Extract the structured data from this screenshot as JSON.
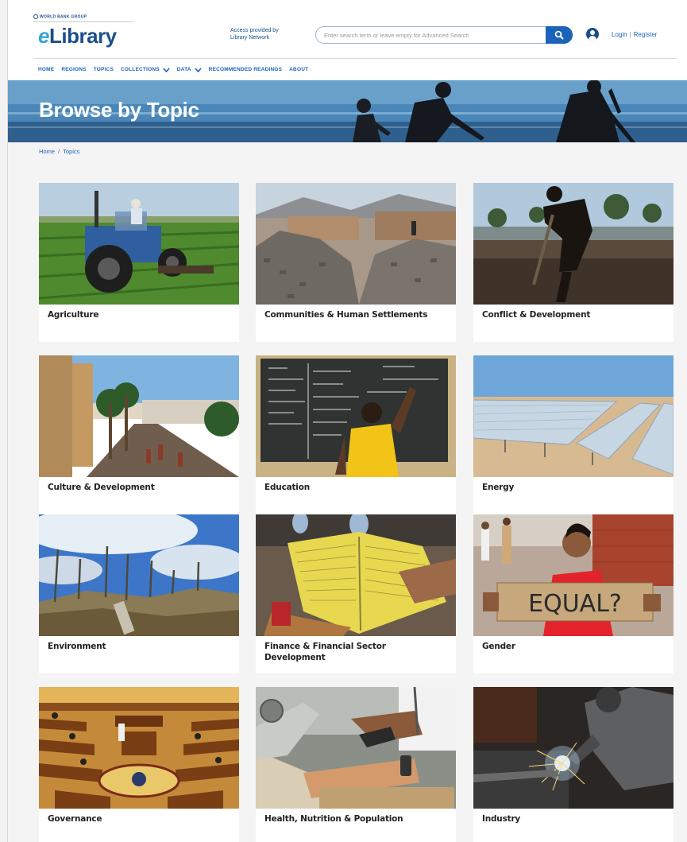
{
  "header": {
    "org": "WORLD BANK GROUP",
    "logo_e": "e",
    "logo_rest": "Library",
    "access_line1": "Access provided by",
    "access_line2": "Library Network",
    "search_placeholder": "Enter search term or leave empty for Advanced Search",
    "login": "Login",
    "separator": "|",
    "register": "Register"
  },
  "nav": {
    "items": [
      "HOME",
      "REGIONS",
      "TOPICS",
      "COLLECTIONS",
      "DATA",
      "RECOMMENDED READINGS",
      "ABOUT"
    ]
  },
  "hero": {
    "title": "Browse by Topic"
  },
  "breadcrumb": {
    "home": "Home",
    "separator": "/",
    "current": "Topics"
  },
  "topics": [
    {
      "label": "Agriculture"
    },
    {
      "label": "Communities & Human Settlements"
    },
    {
      "label": "Conflict & Development"
    },
    {
      "label": "Culture & Development"
    },
    {
      "label": "Education"
    },
    {
      "label": "Energy"
    },
    {
      "label": "Environment"
    },
    {
      "label": "Finance & Financial Sector Development"
    },
    {
      "label": "Gender"
    },
    {
      "label": "Governance"
    },
    {
      "label": "Health, Nutrition & Population"
    },
    {
      "label": "Industry"
    }
  ],
  "images": {
    "gender_sign": "EQUAL?"
  },
  "colors": {
    "brand_blue": "#1a4f8a",
    "link_blue": "#1a63b8",
    "search_button": "#1a63b8"
  }
}
